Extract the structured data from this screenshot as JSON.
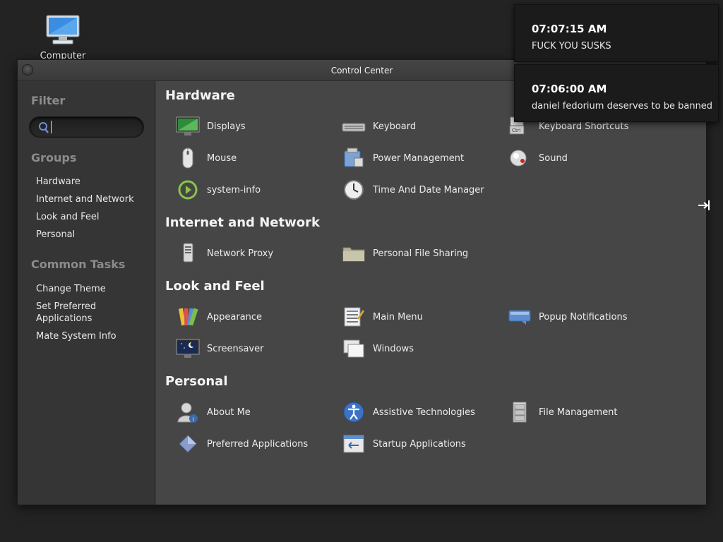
{
  "desktop": {
    "computer_label": "Computer"
  },
  "window": {
    "title": "Control Center"
  },
  "sidebar": {
    "filter_heading": "Filter",
    "search_value": "",
    "groups_heading": "Groups",
    "groups": [
      "Hardware",
      "Internet and Network",
      "Look and Feel",
      "Personal"
    ],
    "tasks_heading": "Common Tasks",
    "tasks": [
      "Change Theme",
      "Set Preferred Applications",
      "Mate System Info"
    ]
  },
  "sections": {
    "hardware": {
      "title": "Hardware",
      "items": [
        "Displays",
        "Keyboard",
        "Keyboard Shortcuts",
        "Mouse",
        "Power Management",
        "Sound",
        "system-info",
        "Time And Date Manager"
      ]
    },
    "network": {
      "title": "Internet and Network",
      "items": [
        "Network Proxy",
        "Personal File Sharing"
      ]
    },
    "look": {
      "title": "Look and Feel",
      "items": [
        "Appearance",
        "Main Menu",
        "Popup Notifications",
        "Screensaver",
        "Windows"
      ]
    },
    "personal": {
      "title": "Personal",
      "items": [
        "About Me",
        "Assistive Technologies",
        "File Management",
        "Preferred Applications",
        "Startup Applications"
      ]
    }
  },
  "notifications": [
    {
      "time": "07:07:15 AM",
      "message": "FUCK YOU SUSKS"
    },
    {
      "time": "07:06:00 AM",
      "message": "daniel fedorium deserves to be banned"
    }
  ],
  "colors": {
    "window_bg": "#464646",
    "sidebar_bg": "#353535",
    "desktop_bg": "#232323",
    "notif_bg": "#1b1b1b"
  }
}
